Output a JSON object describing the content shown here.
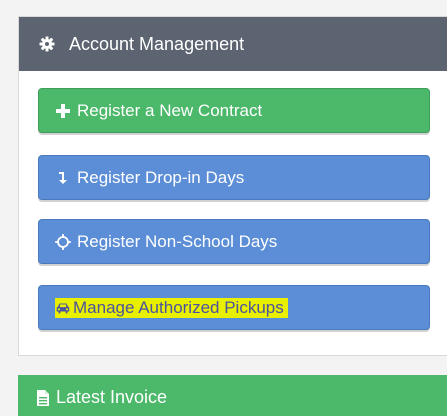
{
  "panel": {
    "title": "Account Management",
    "icon": "gear-icon"
  },
  "buttons": {
    "register_contract": {
      "label": "Register a New Contract",
      "icon": "plus-icon",
      "color": "#4cb86a"
    },
    "register_dropin": {
      "label": "Register Drop-in Days",
      "icon": "arrow-down-icon",
      "color": "#5b8ed6"
    },
    "register_nonschool": {
      "label": "Register Non-School Days",
      "icon": "sun-icon",
      "color": "#5b8ed6"
    },
    "manage_pickups": {
      "label": "Manage Authorized Pickups",
      "icon": "car-icon",
      "color": "#5b8ed6",
      "highlight": "#e8f000"
    }
  },
  "invoice": {
    "title": "Latest Invoice",
    "icon": "document-icon",
    "color": "#4cb86a"
  }
}
